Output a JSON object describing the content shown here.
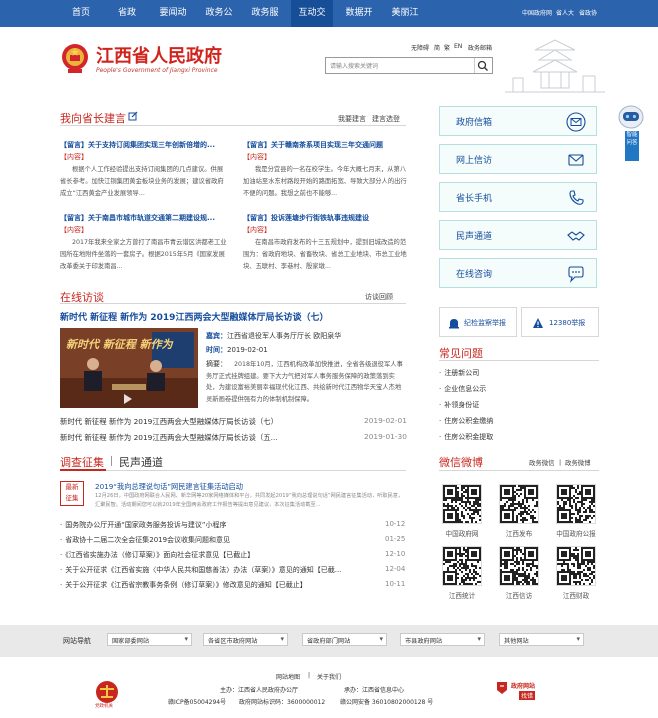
{
  "nav": {
    "items": [
      "首页",
      "省政府",
      "要闻动态",
      "政务公开",
      "政务服务",
      "互动交流",
      "数据开放",
      "美丽江西"
    ],
    "active_index": 5,
    "right_links": [
      "中国政府网",
      "省人大",
      "省政协"
    ]
  },
  "header": {
    "title_cn": "江西省人民政府",
    "title_en": "People's Government of Jiangxi Province",
    "mini_links": [
      "无障碍",
      "简",
      "繁",
      "EN",
      "政务邮箱"
    ],
    "search_placeholder": "请输入搜索关键词"
  },
  "suggestion": {
    "title": "我向省长建言",
    "links": [
      "我要建言",
      "建言选登"
    ],
    "items": [
      {
        "title": "【留言】关于支持订阅集团实现三年创新倍增的...",
        "label": "【内容】",
        "body": "根据个人工作经验提出支持订阅集团的几点建议。供展省长参考。加快江铜集团黄金板块业务的发展；建议省政府成立“江西黄金产业发展领导..."
      },
      {
        "title": "【留言】关于赣南茶系项目实现三年交通问题",
        "label": "【内容】",
        "body": "我是分宜县的一名在校学生。今年大概七月末，从第八加油站至水东村路段开始的路面拓宽、导致大部分人的出行不便的问题。我想之前也不能够..."
      },
      {
        "title": "【留言】关于南昌市城市轨道交通第二期建设规...",
        "label": "【内容】",
        "body": "2017年我来全家之方曾打了南昌市青云谱区洪都老工业园所在地附件坐落的一套房子。根据2015年5月《国家发展改革委关于印发南昌..."
      },
      {
        "title": "【留言】投诉莲塘步行街铁轨事违规建设",
        "label": "【内容】",
        "body": "在南昌市政府发布的十三五规划中，提到旧城改造的范围为：省政府地块、省畜牧块、省总工业地块、市总工业地块、五联村、李巷村、殷家墩..."
      }
    ]
  },
  "services": [
    "政府信箱",
    "网上信访",
    "省长手机",
    "民声通道",
    "在线咨询"
  ],
  "float_box": [
    "智能",
    "问答"
  ],
  "interview": {
    "title": "在线访谈",
    "link": "访谈回顾",
    "feature_title": "新时代 新征程 新作为 2019江西两会大型融媒体厅局长访谈（七）",
    "guest_label": "嘉宾：",
    "guest": "江西省退役军人事务厅厅长 欧阳泉华",
    "time_label": "时间：",
    "time": "2019-02-01",
    "summary_label": "摘要：",
    "summary": "2018年10月，江西机构改革加快推进，全省各级退役军人事务厅正式挂牌组建。要下大力气把对军人事务服务保障的政策落到实处，为建设富裕美丽幸福现代化江西、共绘新时代江西物华天宝人杰地灵新画卷提供强有力的体制机制保障。",
    "video_caption": "新时代 新征程 新作为",
    "list": [
      {
        "text": "新时代 新征程 新作为 2019江西两会大型融媒体厅局长访谈（七）",
        "date": "2019-02-01"
      },
      {
        "text": "新时代 新征程 新作为 2019江西两会大型融媒体厅局长访谈（五...",
        "date": "2019-01-30"
      }
    ]
  },
  "survey": {
    "title": "调查征集",
    "alt_title": "民声通道",
    "badge": [
      "最新",
      "征集"
    ],
    "headline": "2019“我向总理说句话”网民建言征集活动启动",
    "headline_body": "12月26日，中国政府网联合人民网、新华网等20家网络媒体和平台，共同发起2019“我向总理说句话”网民建言征集活动，听取民意，汇聚民智。活动期间您可以就2019年全国两会政府工作报告等提出意见建议，本次征集活动截至...",
    "items": [
      {
        "text": "国务院办公厅开通“国家政务服务投诉与建议”小程序",
        "date": "10-12"
      },
      {
        "text": "省政协十二届二次全会征集2019会议收集问题和意见",
        "date": "01-25"
      },
      {
        "text": "《江西省实施办法（修订草案）》面向社会征求意见【已截止】",
        "date": "12-10"
      },
      {
        "text": "关于公开征求《江西省实施〈中华人民共和国慈善法〉办法（草案）》意见的通知【已截...",
        "date": "12-04"
      },
      {
        "text": "关于公开征求《江西省宗教事务条例（修订草案）》修改意见的通知【已截止】",
        "date": "10-11"
      }
    ]
  },
  "supervision": {
    "report_a": "纪检监察举报",
    "report_b": "12380举报"
  },
  "faq": {
    "title": "常见问题",
    "items": [
      "注册新公司",
      "企业信息公示",
      "补领身份证",
      "住房公积金缴纳",
      "住房公积金提取"
    ]
  },
  "wechat": {
    "title": "微信微博",
    "links": [
      "政务微信",
      "政务微博"
    ],
    "qr_labels": [
      "中国政府网",
      "江西发布",
      "中国政府公报",
      "江西统计",
      "江西信访",
      "江西财政"
    ]
  },
  "footer": {
    "nav_label": "网站导航",
    "selects": [
      "国家部委网站",
      "各省区市政府网站",
      "省政府部门网站",
      "市县政府网站",
      "其他网站"
    ],
    "links": [
      "网站地图",
      "关于我们"
    ],
    "sponsor": "主办：江西省人民政府办公厅",
    "operator": "承办：江西省信息中心",
    "icp": "赣ICP备05004294号",
    "site_code": "政府网站标识码：3600000012",
    "police": "赣公网安备 36010802000128 号",
    "badge_text": [
      "政府网站",
      "找错"
    ],
    "emblem_label": "党政机关"
  },
  "colors": {
    "nav": "#2c63ad",
    "accent_red": "#c8271f",
    "link_blue": "#144d9c"
  }
}
